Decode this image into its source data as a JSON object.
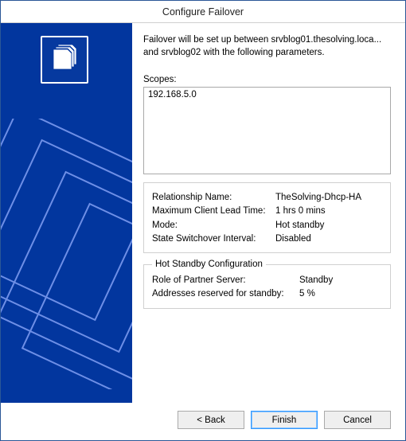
{
  "window": {
    "title": "Configure Failover"
  },
  "intro": "Failover will be set up between srvblog01.thesolving.loca... and srvblog02 with the following parameters.",
  "scopes": {
    "label": "Scopes:",
    "items": [
      "192.168.5.0"
    ]
  },
  "relationship": {
    "rows": [
      {
        "k": "Relationship Name:",
        "v": "TheSolving-Dhcp-HA"
      },
      {
        "k": "Maximum Client Lead Time:",
        "v": "1 hrs 0 mins"
      },
      {
        "k": "Mode:",
        "v": "Hot standby"
      },
      {
        "k": "State Switchover Interval:",
        "v": "Disabled"
      }
    ]
  },
  "hot_standby": {
    "legend": "Hot Standby Configuration",
    "rows": [
      {
        "k": "Role of Partner Server:",
        "v": "Standby"
      },
      {
        "k": "Addresses reserved for standby:",
        "v": "5 %"
      }
    ]
  },
  "buttons": {
    "back": "< Back",
    "finish": "Finish",
    "cancel": "Cancel"
  }
}
